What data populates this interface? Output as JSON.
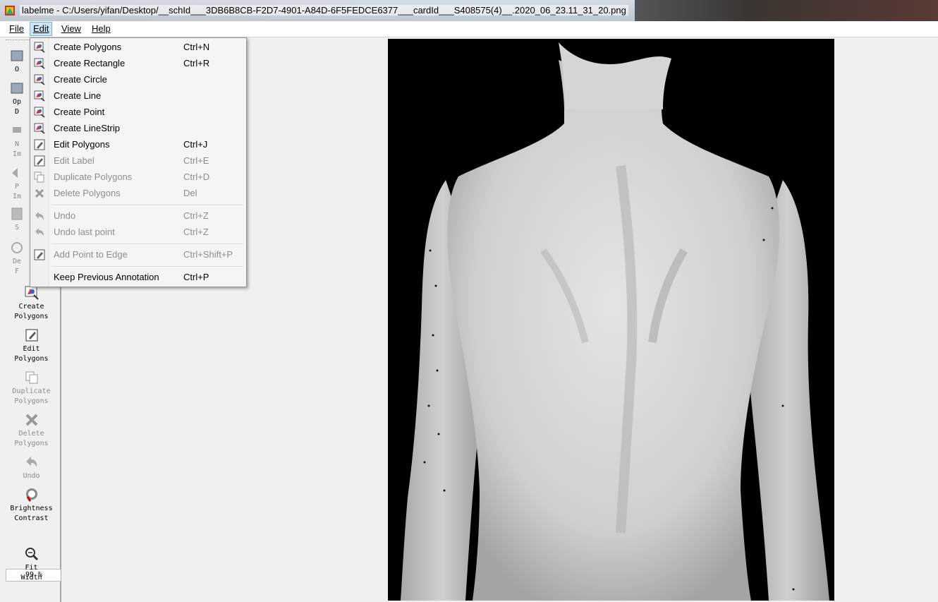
{
  "window": {
    "title": "labelme - C:/Users/yifan/Desktop/__schId___3DB6B8CB-F2D7-4901-A84D-6F5FEDCE6377___cardId___S408575(4)__.2020_06_23.11_31_20.png"
  },
  "menubar": {
    "file": "File",
    "edit": "Edit",
    "view": "View",
    "help": "Help"
  },
  "toolbar": {
    "partial_1": "O",
    "partial_2": "Op",
    "partial_3": "D",
    "partial_4": "N",
    "partial_5": "Im",
    "partial_6": "P",
    "partial_7": "Im",
    "partial_8": "S",
    "partial_9": "De",
    "partial_10": "F",
    "create_polygons": "Create\nPolygons",
    "edit_polygons": "Edit\nPolygons",
    "duplicate_polygons": "Duplicate\nPolygons",
    "delete_polygons": "Delete\nPolygons",
    "undo": "Undo",
    "brightness_contrast": "Brightness\nContrast",
    "zoom": "99 %",
    "fit_width": "Fit\nWidth"
  },
  "edit_menu": {
    "items": [
      {
        "label": "Create Polygons",
        "shortcut": "Ctrl+N",
        "enabled": true,
        "icon": "create-polygon-icon"
      },
      {
        "label": "Create Rectangle",
        "shortcut": "Ctrl+R",
        "enabled": true,
        "icon": "create-polygon-icon"
      },
      {
        "label": "Create Circle",
        "shortcut": "",
        "enabled": true,
        "icon": "create-polygon-icon"
      },
      {
        "label": "Create Line",
        "shortcut": "",
        "enabled": true,
        "icon": "create-polygon-icon"
      },
      {
        "label": "Create Point",
        "shortcut": "",
        "enabled": true,
        "icon": "create-polygon-icon"
      },
      {
        "label": "Create LineStrip",
        "shortcut": "",
        "enabled": true,
        "icon": "create-polygon-icon"
      },
      {
        "label": "Edit Polygons",
        "shortcut": "Ctrl+J",
        "enabled": true,
        "icon": "edit-icon"
      },
      {
        "label": "Edit Label",
        "shortcut": "Ctrl+E",
        "enabled": false,
        "icon": "edit-icon"
      },
      {
        "label": "Duplicate Polygons",
        "shortcut": "Ctrl+D",
        "enabled": false,
        "icon": "copy-icon"
      },
      {
        "label": "Delete Polygons",
        "shortcut": "Del",
        "enabled": false,
        "icon": "delete-icon"
      },
      {
        "label": "Undo",
        "shortcut": "Ctrl+Z",
        "enabled": false,
        "icon": "undo-icon"
      },
      {
        "label": "Undo last point",
        "shortcut": "Ctrl+Z",
        "enabled": false,
        "icon": "undo-icon"
      },
      {
        "label": "Add Point to Edge",
        "shortcut": "Ctrl+Shift+P",
        "enabled": false,
        "icon": "edit-icon"
      },
      {
        "label": "Keep Previous Annotation",
        "shortcut": "Ctrl+P",
        "enabled": true,
        "icon": ""
      }
    ]
  }
}
